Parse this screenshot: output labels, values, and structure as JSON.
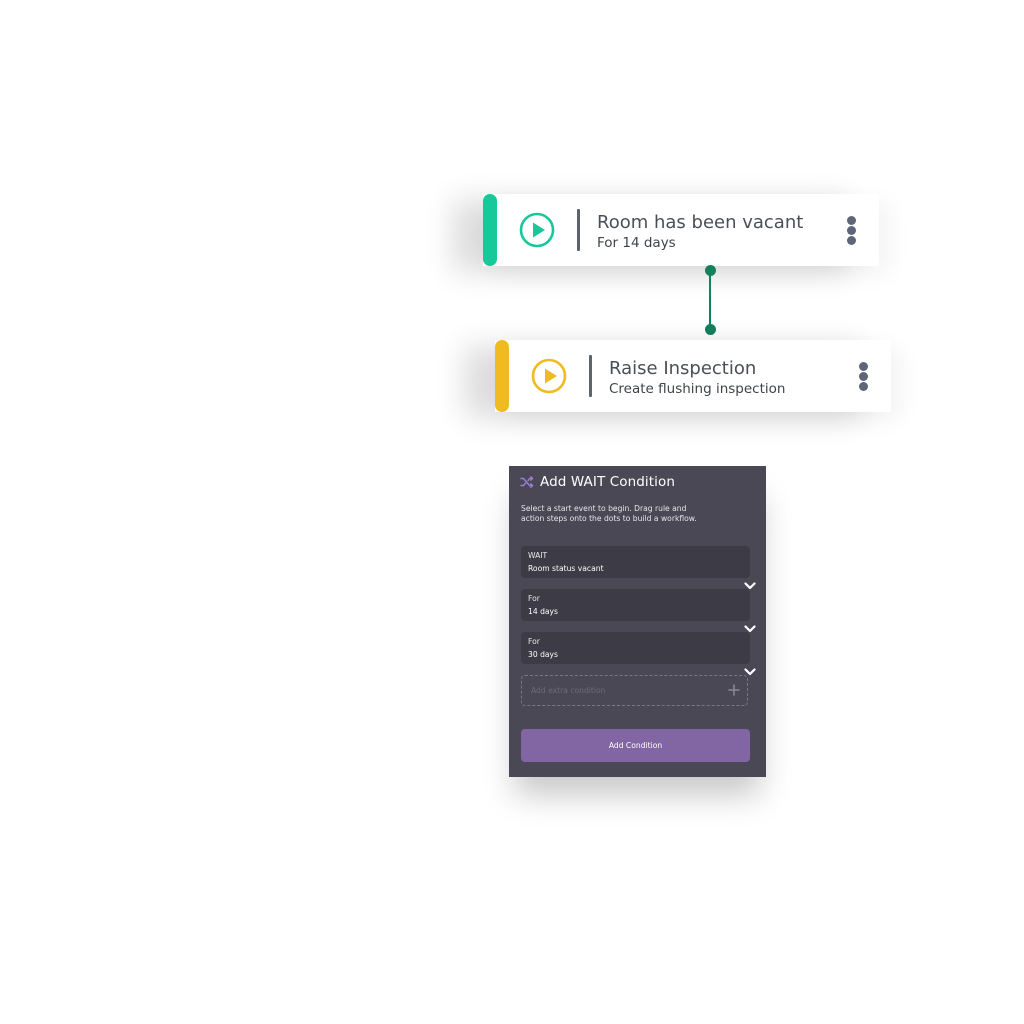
{
  "colors": {
    "trigger_accent": "#17c99a",
    "action_accent": "#efbb21",
    "connector": "#14805e",
    "panel_bg": "#4a4854",
    "field_bg": "#3d3b45",
    "button_bg": "#8266a4",
    "shuffle_icon": "#9b7fd6"
  },
  "workflow": {
    "steps": [
      {
        "title": "Room has been vacant",
        "subtitle": "For 14 days",
        "icon": "play-circle-icon",
        "menu_icon": "kebab-menu-icon"
      },
      {
        "title": "Raise Inspection",
        "subtitle": "Create flushing inspection",
        "icon": "play-circle-icon",
        "menu_icon": "kebab-menu-icon"
      }
    ]
  },
  "panel": {
    "icon": "shuffle-icon",
    "title": "Add WAIT Condition",
    "description": "Select a start event to begin. Drag rule and action steps onto the dots to build a workflow.",
    "fields": [
      {
        "label": "WAIT",
        "value": "Room status vacant"
      },
      {
        "label": "For",
        "value": "14 days"
      },
      {
        "label": "For",
        "value": "30 days"
      }
    ],
    "extra_condition_placeholder": "Add extra condition",
    "add_button_label": "Add Condition"
  }
}
